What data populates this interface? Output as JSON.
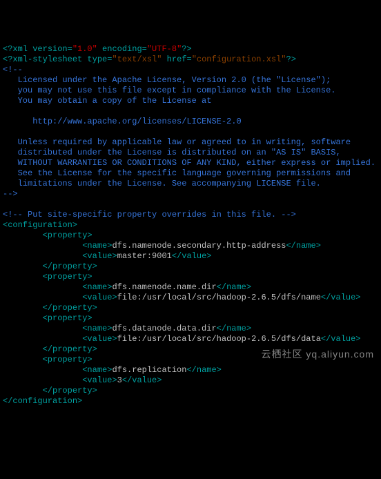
{
  "xml_decl": {
    "open": "<?",
    "name": "xml",
    "version_attr": " version",
    "version_val": "\"1.0\"",
    "encoding_attr": " encoding",
    "encoding_val": "\"UTF-8\"",
    "close": "?>"
  },
  "stylesheet": {
    "open": "<?",
    "name": "xml-stylesheet",
    "type_attr": " type",
    "type_val": "\"text/xsl\"",
    "href_attr": " href",
    "href_val": "\"configuration.xsl\"",
    "close": "?>"
  },
  "license": {
    "open": "<!--",
    "l1": "   Licensed under the Apache License, Version 2.0 (the \"License\");",
    "l2": "   you may not use this file except in compliance with the License.",
    "l3": "   You may obtain a copy of the License at",
    "blank1": "",
    "l4": "      http://www.apache.org/licenses/LICENSE-2.0",
    "blank2": "",
    "l5": "   Unless required by applicable law or agreed to in writing, software",
    "l6": "   distributed under the License is distributed on an \"AS IS\" BASIS,",
    "l7": "   WITHOUT WARRANTIES OR CONDITIONS OF ANY KIND, either express or implied.",
    "l8": "   See the License for the specific language governing permissions and",
    "l9": "   limitations under the License. See accompanying LICENSE file.",
    "close": "-->"
  },
  "comment2": "<!-- Put site-specific property overrides in this file. -->",
  "root": {
    "open": "<configuration>",
    "close": "</configuration>"
  },
  "prop_open": "<property>",
  "prop_close": "</property>",
  "name_open": "<name>",
  "name_close": "</name>",
  "value_open": "<value>",
  "value_close": "</value>",
  "p1": {
    "name": "dfs.namenode.secondary.http-address",
    "value": "master:9001"
  },
  "p2": {
    "name": "dfs.namenode.name.dir",
    "value": "file:/usr/local/src/hadoop-2.6.5/dfs/name"
  },
  "p3": {
    "name": "dfs.datanode.data.dir",
    "value": "file:/usr/local/src/hadoop-2.6.5/dfs/data"
  },
  "p4": {
    "name": "dfs.replication",
    "value": "3"
  },
  "watermark": "云栖社区 yq.aliyun.com"
}
